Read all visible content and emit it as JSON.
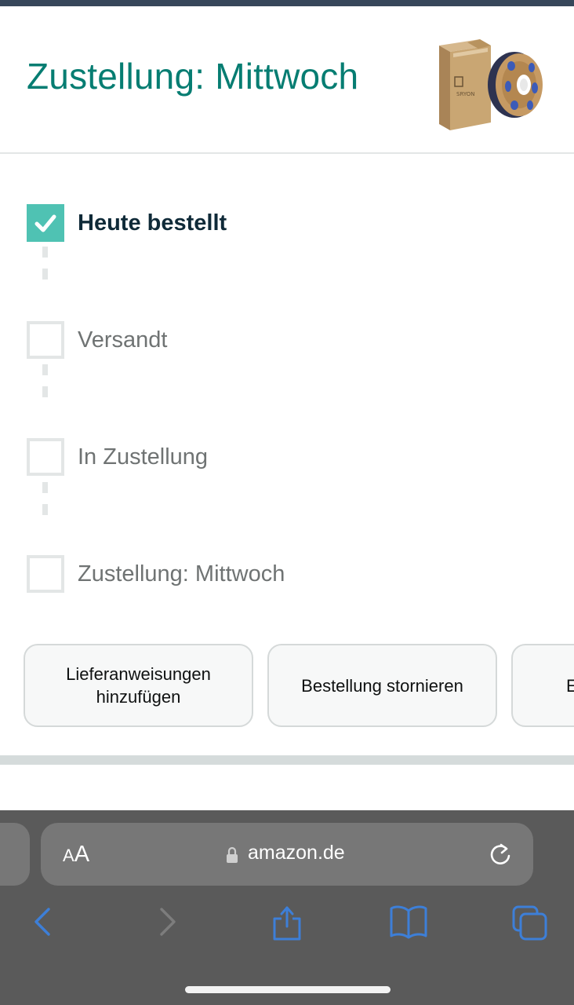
{
  "header": {
    "title": "Zustellung: Mittwoch"
  },
  "tracker": {
    "steps": [
      {
        "label": "Heute bestellt",
        "completed": true
      },
      {
        "label": "Versandt",
        "completed": false
      },
      {
        "label": "In Zustellung",
        "completed": false
      },
      {
        "label": "Zustellung: Mittwoch",
        "completed": false
      }
    ]
  },
  "actions": {
    "delivery_instructions_line1": "Lieferanweisungen",
    "delivery_instructions_line2": "hinzufügen",
    "cancel_order": "Bestellung stornieren",
    "third_partial": "E"
  },
  "browser": {
    "aa_small": "A",
    "aa_large": "A",
    "url": "amazon.de"
  },
  "colors": {
    "accent_teal": "#067d72",
    "check_teal": "#4fc2b3",
    "safari_bar": "#5a5a5a",
    "toolbar_blue": "#3d7fd8"
  }
}
